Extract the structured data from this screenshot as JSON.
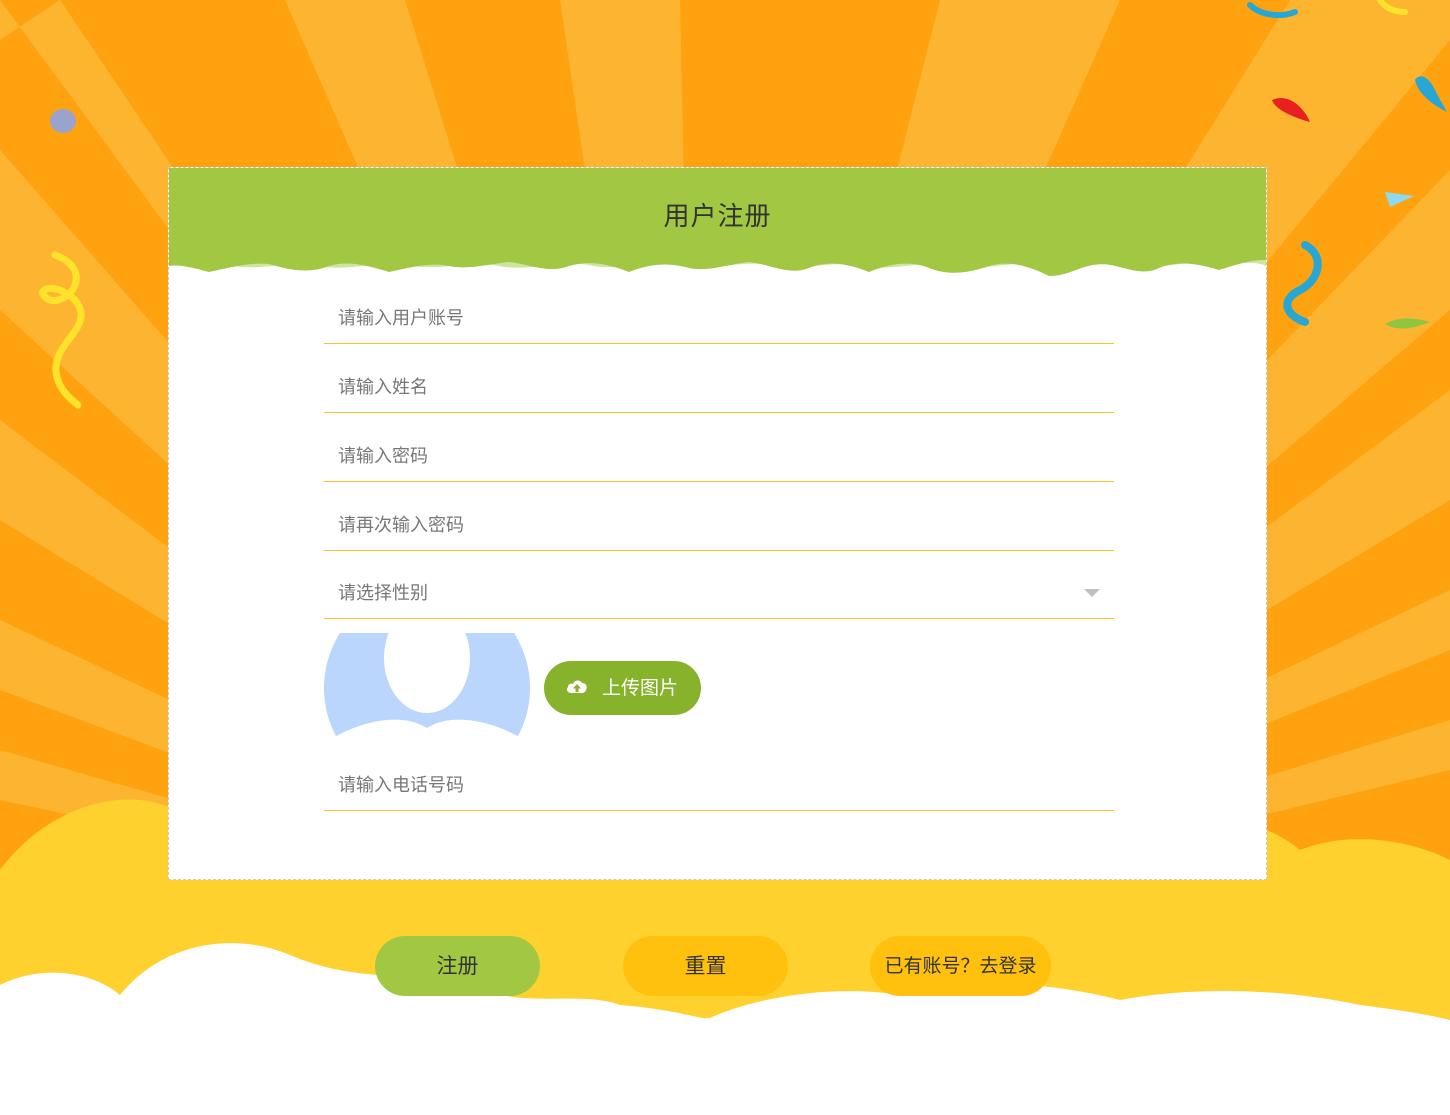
{
  "colors": {
    "background_orange": "#ffa210",
    "ray": "#fdb734",
    "cloud_yellow": "#ffd12f",
    "header_green": "#a2c843",
    "field_underline": "#f6c32f",
    "upload_green": "#86b22c",
    "reset_yellow": "#ffc10d",
    "avatar_blue": "#bad6fd"
  },
  "form": {
    "title": "用户注册",
    "fields": [
      {
        "name": "username",
        "placeholder": "请输入用户账号",
        "value": ""
      },
      {
        "name": "realname",
        "placeholder": "请输入姓名",
        "value": ""
      },
      {
        "name": "password",
        "placeholder": "请输入密码",
        "value": ""
      },
      {
        "name": "confirm_password",
        "placeholder": "请再次输入密码",
        "value": ""
      },
      {
        "name": "phone",
        "placeholder": "请输入电话号码",
        "value": ""
      }
    ],
    "gender_select": {
      "placeholder": "请选择性别"
    },
    "avatar_icon": "avatar-placeholder-icon",
    "upload": {
      "label": "上传图片",
      "icon": "cloud-upload-icon"
    }
  },
  "actions": {
    "register": "注册",
    "reset": "重置",
    "to_login": "已有账号？去登录"
  }
}
